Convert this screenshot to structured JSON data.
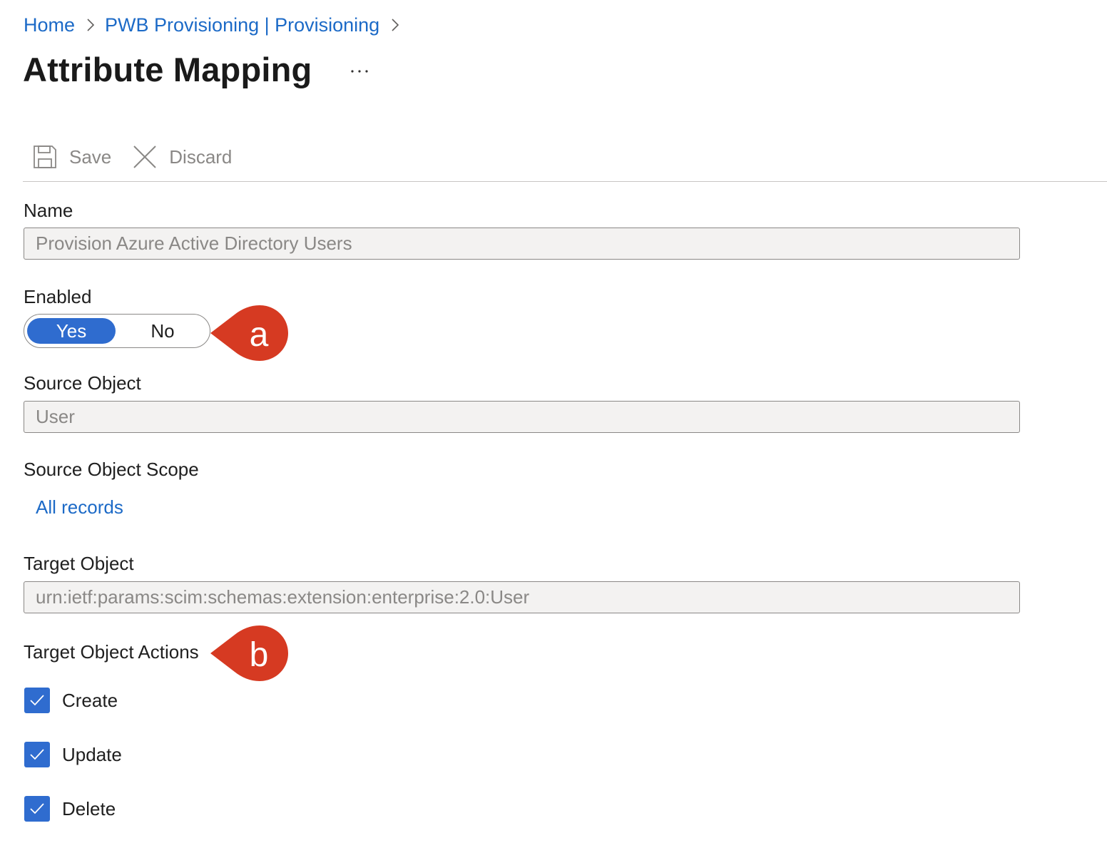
{
  "breadcrumb": {
    "items": [
      {
        "label": "Home"
      },
      {
        "label": "PWB Provisioning | Provisioning"
      }
    ]
  },
  "page": {
    "title": "Attribute Mapping",
    "more_label": "···"
  },
  "toolbar": {
    "save_label": "Save",
    "discard_label": "Discard",
    "save_icon": "save-icon",
    "discard_icon": "close-icon"
  },
  "form": {
    "name": {
      "label": "Name",
      "value": "Provision Azure Active Directory Users"
    },
    "enabled": {
      "label": "Enabled",
      "options": [
        "Yes",
        "No"
      ],
      "selected": "Yes"
    },
    "source_object": {
      "label": "Source Object",
      "value": "User"
    },
    "source_object_scope": {
      "label": "Source Object Scope",
      "link_text": "All records"
    },
    "target_object": {
      "label": "Target Object",
      "value": "urn:ietf:params:scim:schemas:extension:enterprise:2.0:User"
    },
    "target_object_actions": {
      "label": "Target Object Actions",
      "actions": [
        {
          "label": "Create",
          "checked": true
        },
        {
          "label": "Update",
          "checked": true
        },
        {
          "label": "Delete",
          "checked": true
        }
      ]
    }
  },
  "callouts": [
    {
      "label": "a"
    },
    {
      "label": "b"
    }
  ],
  "colors": {
    "accent": "#2f6ccf",
    "link": "#1c6ac7",
    "callout": "#d63a22",
    "muted_text": "#8a8886",
    "readonly_bg": "#f3f2f1"
  }
}
